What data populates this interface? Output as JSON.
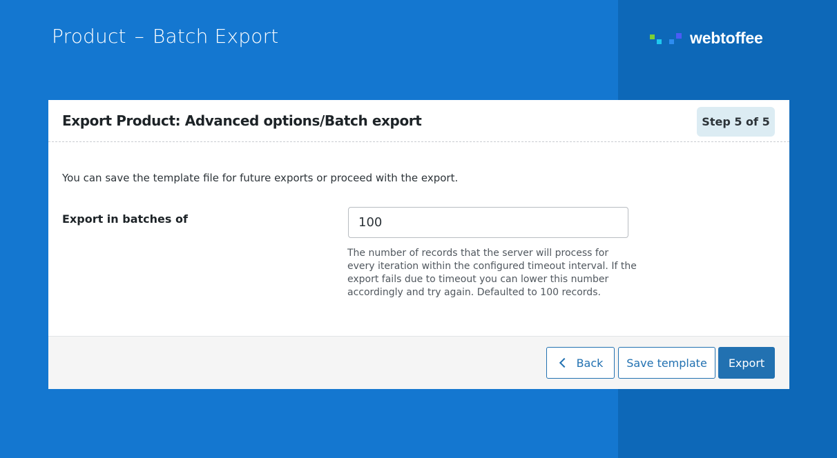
{
  "page": {
    "title_part1": "Product",
    "title_separator": "–",
    "title_part2": "Batch Export"
  },
  "brand": {
    "name": "webtoffee",
    "logo_colors": [
      "#7bd035",
      "#1ec8f0",
      "#2d8cf0",
      "#4a5cf5"
    ]
  },
  "card": {
    "title": "Export Product: Advanced options/Batch export",
    "step_label": "Step 5 of 5",
    "intro_text": "You can save the template file for future exports or proceed with the export.",
    "batch_field": {
      "label": "Export in batches of",
      "value": "100",
      "help": "The number of records that the server will process for every iteration within the configured timeout interval. If the export fails due to timeout you can lower this number accordingly and try again. Defaulted to 100 records."
    }
  },
  "footer": {
    "back_label": "Back",
    "save_template_label": "Save template",
    "export_label": "Export"
  },
  "colors": {
    "background": "#1477d0",
    "background_right": "#0d68b8",
    "primary": "#2271b1",
    "step_badge": "#dcecf3"
  }
}
